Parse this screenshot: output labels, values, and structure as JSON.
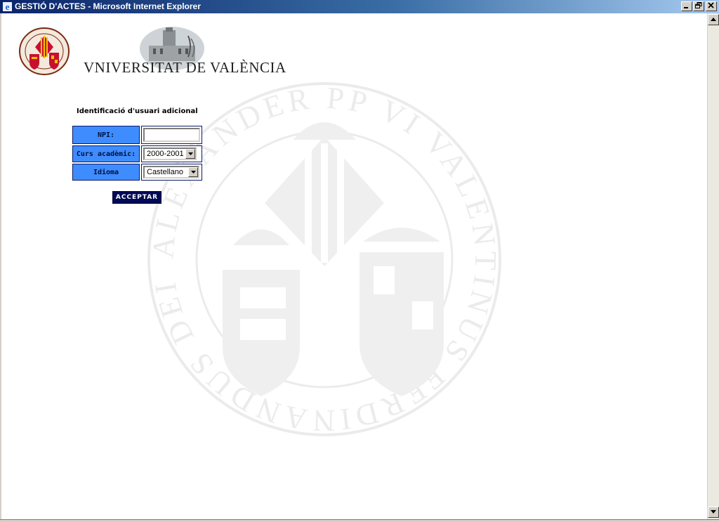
{
  "window": {
    "title": "GESTIÓ D'ACTES - Microsoft Internet Explorer",
    "minimize_icon": "minimize-icon",
    "maximize_icon": "restore-icon",
    "close_icon": "close-icon"
  },
  "header": {
    "university_name": "VNIVERSITAT DE VALÈNCIA",
    "watermark_text": "ALEXANDER PP VI VALENTINUS FERDINANDUS DEI GRA REX ARAGONUM"
  },
  "form": {
    "title": "Identificació d'usuari adicional",
    "npi_label": "NPI:",
    "npi_value": "",
    "year_label": "Curs acadèmic:",
    "year_selected": "2000-2001",
    "language_label": "Idioma",
    "language_selected": "Castellano",
    "submit_label": "ACCEPTAR"
  },
  "colors": {
    "label_bg": "#3f8cff",
    "button_bg": "#000a55",
    "titlebar": "#0a246a"
  }
}
